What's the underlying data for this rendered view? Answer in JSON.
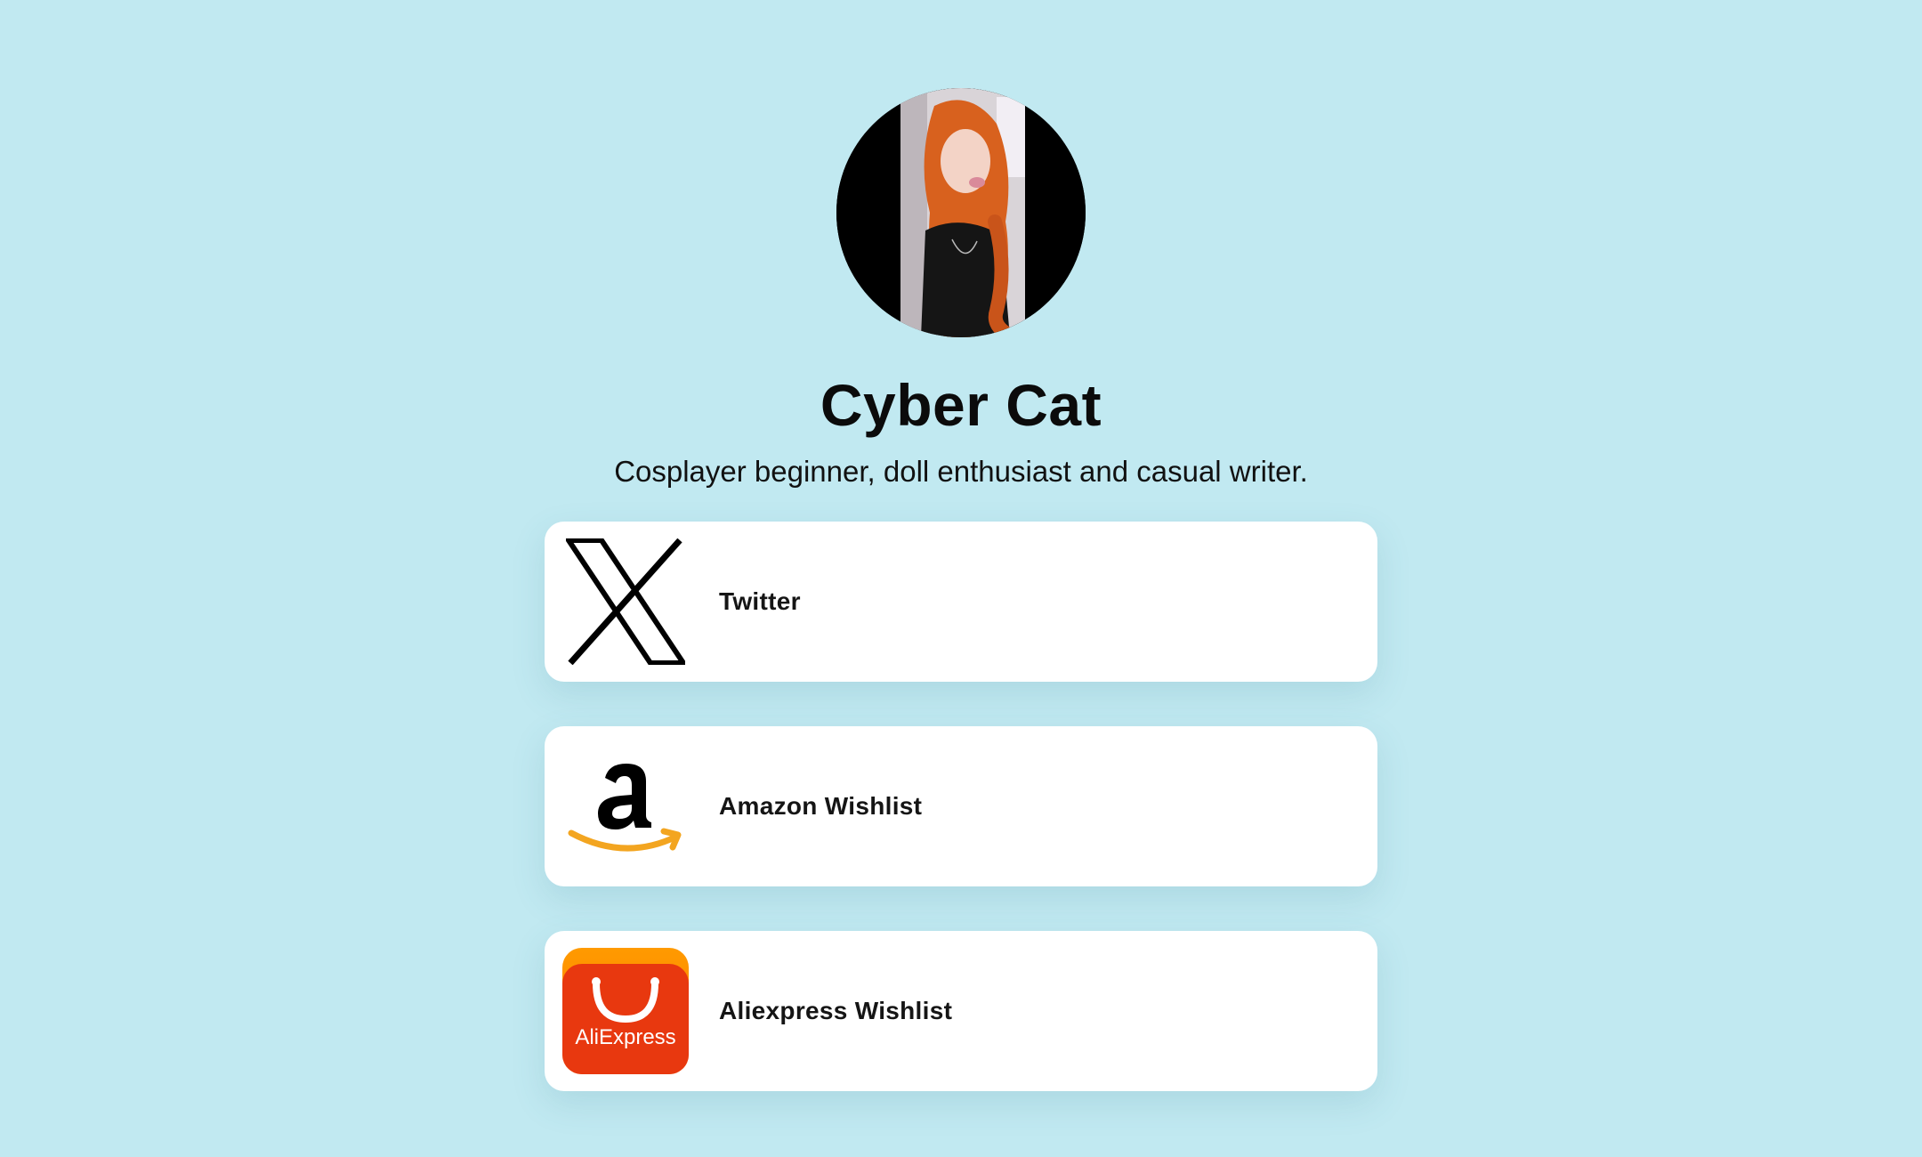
{
  "profile": {
    "name": "Cyber Cat",
    "bio": "Cosplayer beginner, doll enthusiast and casual writer."
  },
  "links": [
    {
      "label": "Twitter",
      "icon": "x-logo-icon"
    },
    {
      "label": "Amazon Wishlist",
      "icon": "amazon-logo-icon"
    },
    {
      "label": "Aliexpress Wishlist",
      "icon": "aliexpress-logo-icon",
      "icon_text": "AliExpress"
    }
  ],
  "colors": {
    "background": "#c1e9f1",
    "card": "#ffffff",
    "amazon_smile": "#f3a520",
    "aliexpress_red": "#e8380f",
    "aliexpress_orange": "#ff8a00"
  }
}
